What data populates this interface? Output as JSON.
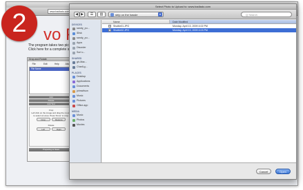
{
  "badge": {
    "number": "2"
  },
  "browser": {
    "title": "Two Fey Acrossin",
    "url": "www.badlado.com/acrossin/",
    "button": "RSS",
    "search_placeholder": "Google"
  },
  "page": {
    "logo": "vo F",
    "description": "The program takes two pictures. Click here for a complete step"
  },
  "app_panel": {
    "header": "Drop and Rotate",
    "tabs": [
      "File",
      "Edit",
      "Help",
      "About"
    ],
    "list_header": "File Name",
    "buttons": [
      "Add",
      "Rotate",
      "Add Text"
    ],
    "body_title": "Crop",
    "body_text": "Left click on the image and drag the mouse to select an area. Press 'Done' to crop.",
    "crop_buttons": [
      "Crop",
      "Restore"
    ],
    "rotate_title": "Rotate",
    "rotate_buttons": [
      "Left",
      "Right"
    ],
    "footer": "Preparing to Save"
  },
  "dialog": {
    "title": "Select Photo to Upload to: www.badlado.com",
    "back": "◀",
    "forward": "▶",
    "view_icon": "☰",
    "view_columns": "▥",
    "location": "strip on the hassle",
    "search_placeholder": "Q Search",
    "column_name": "Name",
    "column_date": "Date Modified",
    "files": [
      {
        "name": "Shuttle01.JPG",
        "date": "Monday, April 13, 2009 4:02 PM",
        "selected": false
      },
      {
        "name": "Shuttle02.JPG",
        "date": "Monday, April 13, 2009 4:03 PM",
        "selected": true
      }
    ],
    "cancel": "Cancel",
    "open": "Open"
  },
  "sidebar": {
    "devices_title": "DEVICES",
    "devices": [
      {
        "label": "sandy_pu...",
        "color": "#8a8a8a"
      },
      {
        "label": "iDisk",
        "color": "#5b8ed8"
      },
      {
        "label": "sandy_pu...",
        "color": "#8a8a8a"
      },
      {
        "label": "Apps",
        "color": "#9aa4b0"
      },
      {
        "label": "Disorder",
        "color": "#9aa4b0"
      },
      {
        "label": "Sort c...",
        "color": "#9aa4b0"
      }
    ],
    "shared_title": "SHARED",
    "shared": [
      {
        "label": "gh-Mac...",
        "color": "#6a7e9a"
      },
      {
        "label": "CharlLg...",
        "color": "#6a7e9a"
      }
    ],
    "places_title": "PLACES",
    "places": [
      {
        "label": "Desktop",
        "color": "#6a8fd8"
      },
      {
        "label": "Applications",
        "color": "#8a6ad8"
      },
      {
        "label": "Documents",
        "color": "#6a8fd8"
      },
      {
        "label": "johnwilson",
        "color": "#d89a4a"
      },
      {
        "label": "Music",
        "color": "#6a8fd8"
      },
      {
        "label": "Pictures",
        "color": "#6a8fd8"
      },
      {
        "label": "Office.app",
        "color": "#c94a4a"
      }
    ],
    "media_title": "MEDIA",
    "media": [
      {
        "label": "Music",
        "color": "#6a8fd8"
      },
      {
        "label": "Photos",
        "color": "#6ab06a"
      },
      {
        "label": "Movies",
        "color": "#555555"
      }
    ]
  }
}
